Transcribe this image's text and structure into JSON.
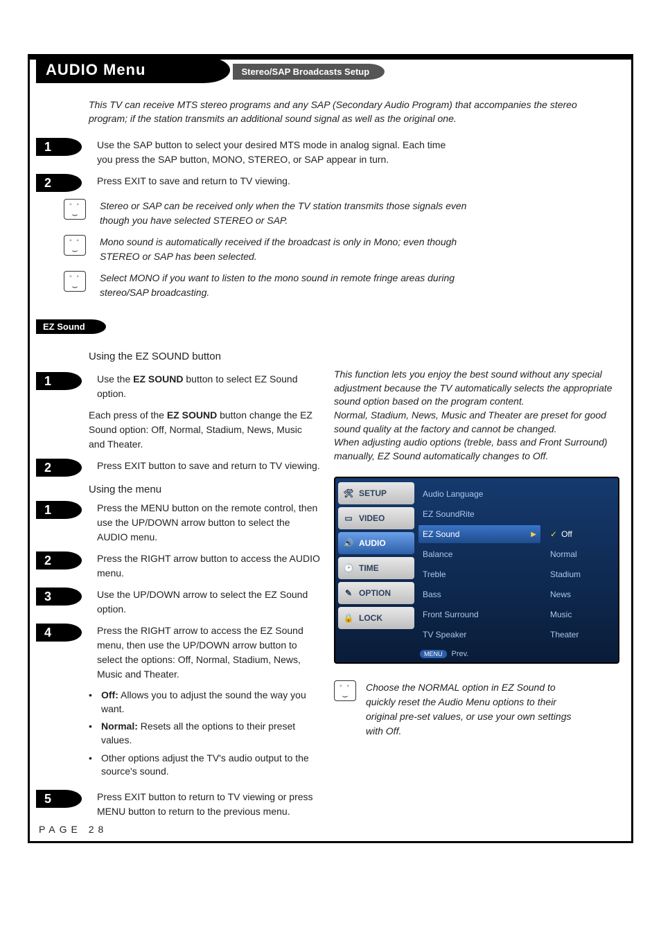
{
  "title": "AUDIO Menu",
  "section1": {
    "heading": "Stereo/SAP Broadcasts Setup",
    "intro": "This TV can receive MTS stereo programs and any SAP (Secondary Audio Program) that accompanies the stereo program; if the station transmits an additional sound signal as well as the original one.",
    "steps": [
      {
        "num": "1",
        "text": "Use the SAP button to select your desired MTS mode in analog signal. Each time you press the SAP button, MONO, STEREO, or SAP appear in turn."
      },
      {
        "num": "2",
        "text": "Press EXIT to save and return to TV viewing."
      }
    ],
    "notes": [
      "Stereo or SAP can be received only when the TV station transmits those signals even though you have selected STEREO or SAP.",
      "Mono sound is automatically received if the broadcast is only in Mono; even though STEREO or SAP has been selected.",
      "Select MONO if you want to listen to the mono sound in remote fringe areas during stereo/SAP broadcasting."
    ]
  },
  "section2": {
    "heading": "EZ Sound",
    "sub1_title": "Using the EZ SOUND button",
    "sub1_steps": [
      {
        "num": "1",
        "html_lead": "Use the ",
        "html_bold": "EZ SOUND",
        "html_tail": " button to select EZ Sound option."
      },
      {
        "num": "2",
        "text": "Press EXIT button to save and return to TV viewing."
      }
    ],
    "sub1_extra_lead": "Each press of the ",
    "sub1_extra_bold": "EZ SOUND",
    "sub1_extra_tail": " button change the EZ Sound option: Off, Normal, Stadium, News, Music and Theater.",
    "right_desc": "This function lets you enjoy the best sound without any special adjustment because the TV automatically selects the appropriate sound option based on the program content.\nNormal, Stadium, News, Music and Theater are preset for good sound quality at the factory and cannot be changed.\nWhen adjusting audio options (treble, bass and Front Surround) manually, EZ Sound automatically changes to Off.",
    "sub2_title": "Using the menu",
    "sub2_steps": [
      {
        "num": "1",
        "text": "Press the MENU button on the remote control, then use the UP/DOWN arrow button to select the AUDIO menu."
      },
      {
        "num": "2",
        "text": "Press the RIGHT arrow button to access the AUDIO menu."
      },
      {
        "num": "3",
        "text": "Use the UP/DOWN arrow to select the EZ Sound option."
      },
      {
        "num": "4",
        "text": "Press the RIGHT arrow to access the EZ Sound menu, then use the UP/DOWN arrow button to select the options: Off, Normal, Stadium, News, Music and Theater."
      }
    ],
    "bullets": [
      {
        "bold": "Off:",
        "text": " Allows you to adjust the sound the way you want."
      },
      {
        "bold": "Normal:",
        "text": " Resets all the options to their preset values."
      },
      {
        "bold": "",
        "text": "Other options adjust the TV's audio output to the source's sound."
      }
    ],
    "final_step": {
      "num": "5",
      "text": "Press EXIT button to return to TV viewing or press MENU button to return to the previous menu."
    },
    "right_note": "Choose the NORMAL option in EZ Sound to quickly reset the Audio Menu options to their original pre-set values, or use your own settings with Off."
  },
  "tv_menu": {
    "tabs": [
      {
        "icon": "🛠",
        "label": "SETUP"
      },
      {
        "icon": "▭",
        "label": "VIDEO"
      },
      {
        "icon": "🔊",
        "label": "AUDIO",
        "active": true
      },
      {
        "icon": "🕑",
        "label": "TIME"
      },
      {
        "icon": "✎",
        "label": "OPTION"
      },
      {
        "icon": "🔒",
        "label": "LOCK"
      }
    ],
    "items": [
      "Audio Language",
      "EZ SoundRite",
      "EZ Sound",
      "Balance",
      "Treble",
      "Bass",
      "Front Surround",
      "TV Speaker"
    ],
    "selected_index": 2,
    "sub_items": [
      "Off",
      "Normal",
      "Stadium",
      "News",
      "Music",
      "Theater"
    ],
    "sub_selected_index": 0,
    "prev_label": "Prev.",
    "prev_badge": "MENU"
  },
  "page_number": "PAGE 28"
}
